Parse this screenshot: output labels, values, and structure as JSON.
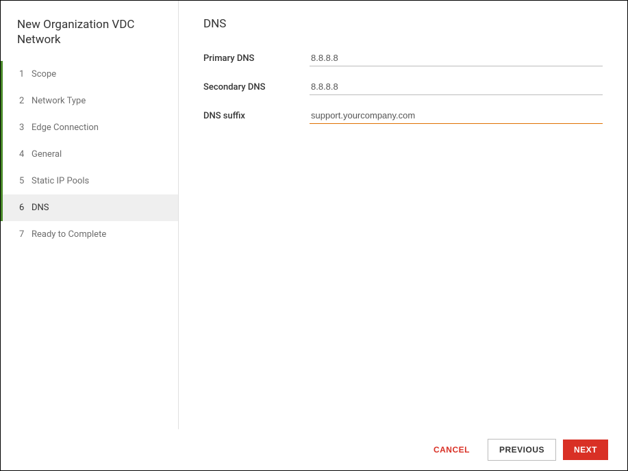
{
  "sidebar": {
    "title": "New Organization VDC Network",
    "steps": [
      {
        "num": "1",
        "label": "Scope",
        "state": "completed"
      },
      {
        "num": "2",
        "label": "Network Type",
        "state": "completed"
      },
      {
        "num": "3",
        "label": "Edge Connection",
        "state": "completed"
      },
      {
        "num": "4",
        "label": "General",
        "state": "completed"
      },
      {
        "num": "5",
        "label": "Static IP Pools",
        "state": "completed"
      },
      {
        "num": "6",
        "label": "DNS",
        "state": "active"
      },
      {
        "num": "7",
        "label": "Ready to Complete",
        "state": "upcoming"
      }
    ]
  },
  "main": {
    "title": "DNS",
    "fields": {
      "primary_dns_label": "Primary DNS",
      "primary_dns_value": "8.8.8.8",
      "secondary_dns_label": "Secondary DNS",
      "secondary_dns_value": "8.8.8.8",
      "dns_suffix_label": "DNS suffix",
      "dns_suffix_value": "support.yourcompany.com"
    }
  },
  "footer": {
    "cancel": "CANCEL",
    "previous": "PREVIOUS",
    "next": "NEXT"
  }
}
